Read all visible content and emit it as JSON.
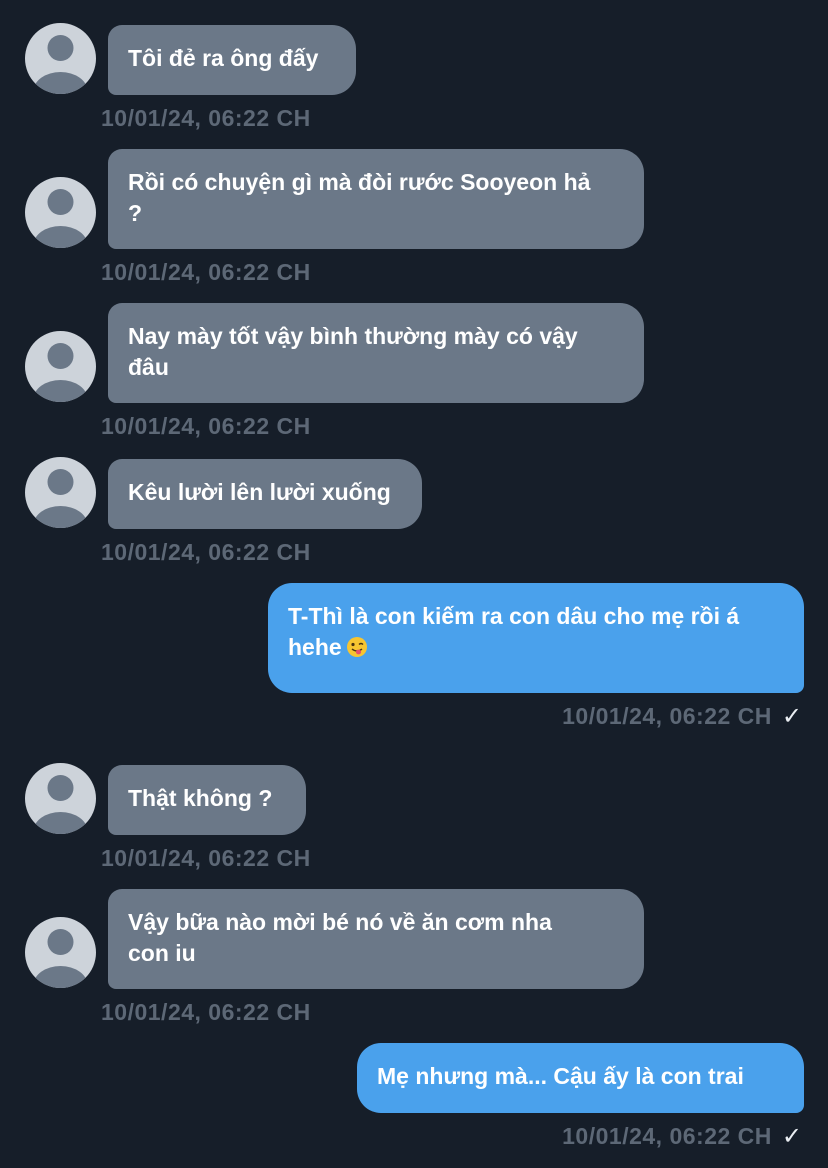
{
  "colors": {
    "background": "#161e29",
    "incoming_bubble": "#6b7888",
    "outgoing_bubble": "#4aa1ec",
    "timestamp": "#5d6876",
    "avatar": "#cdd3da"
  },
  "messages": [
    {
      "direction": "in",
      "text": "Tôi đẻ ra ông đấy",
      "time": "10/01/24, 06:22 CH"
    },
    {
      "direction": "in",
      "text": "Rồi có chuyện gì mà đòi rước Sooyeon hả\n?",
      "time": "10/01/24, 06:22 CH"
    },
    {
      "direction": "in",
      "text": "Nay mày tốt vậy bình thường mày có vậy\nđâu",
      "time": "10/01/24, 06:22 CH"
    },
    {
      "direction": "in",
      "text": "Kêu lười lên lười xuống",
      "time": "10/01/24, 06:22 CH"
    },
    {
      "direction": "out",
      "text": "T-Thì là con kiếm ra con dâu cho mẹ rồi á\nhehe",
      "emoji": "winking-face-with-tongue",
      "time": "10/01/24, 06:22 CH",
      "status": "✓"
    },
    {
      "direction": "in",
      "text": "Thật không ?",
      "time": "10/01/24, 06:22 CH"
    },
    {
      "direction": "in",
      "text": "Vậy bữa nào mời bé nó về ăn cơm nha\ncon iu",
      "time": "10/01/24, 06:22 CH"
    },
    {
      "direction": "out",
      "text": "Mẹ nhưng mà... Cậu ấy là con trai",
      "time": "10/01/24, 06:22 CH",
      "status": "✓"
    }
  ]
}
